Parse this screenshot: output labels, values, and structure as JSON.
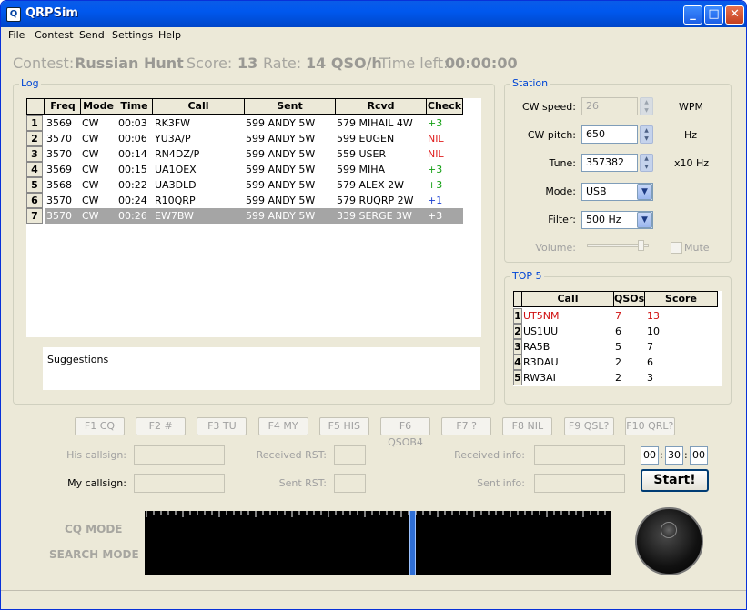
{
  "window": {
    "title": "QRPSim",
    "icon_text": "Q"
  },
  "menu": [
    "File",
    "Contest",
    "Send",
    "Settings",
    "Help"
  ],
  "header": {
    "contest_label": "Contest:",
    "contest_value": "Russian Hunt",
    "score_label": "Score:",
    "score_value": "13",
    "rate_label": "Rate:",
    "rate_value": "14 QSO/h",
    "time_label": "Time left:",
    "time_value": "00:00:00"
  },
  "log": {
    "label": "Log",
    "columns": [
      "Freq",
      "Mode",
      "Time",
      "Call",
      "Sent",
      "Rcvd",
      "Check"
    ],
    "rows": [
      {
        "n": "1",
        "freq": "3569",
        "mode": "CW",
        "time": "00:03",
        "call": "RK3FW",
        "sent": "599 ANDY 5W",
        "rcvd": "579 MIHAIL 4W",
        "check": "+3",
        "check_color": "#16a016"
      },
      {
        "n": "2",
        "freq": "3570",
        "mode": "CW",
        "time": "00:06",
        "call": "YU3A/P",
        "sent": "599 ANDY 5W",
        "rcvd": "599 EUGEN",
        "check": "NIL",
        "check_color": "#e02020"
      },
      {
        "n": "3",
        "freq": "3570",
        "mode": "CW",
        "time": "00:14",
        "call": "RN4DZ/P",
        "sent": "599 ANDY 5W",
        "rcvd": "559 USER",
        "check": "NIL",
        "check_color": "#e02020"
      },
      {
        "n": "4",
        "freq": "3569",
        "mode": "CW",
        "time": "00:15",
        "call": "UA1OEX",
        "sent": "599 ANDY 5W",
        "rcvd": "599 MIHA",
        "check": "+3",
        "check_color": "#16a016"
      },
      {
        "n": "5",
        "freq": "3568",
        "mode": "CW",
        "time": "00:22",
        "call": "UA3DLD",
        "sent": "599 ANDY 5W",
        "rcvd": "579 ALEX 2W",
        "check": "+3",
        "check_color": "#16a016"
      },
      {
        "n": "6",
        "freq": "3570",
        "mode": "CW",
        "time": "00:24",
        "call": "R10QRP",
        "sent": "599 ANDY 5W",
        "rcvd": "579 RUQRP 2W",
        "check": "+1",
        "check_color": "#1a3fd0"
      },
      {
        "n": "7",
        "freq": "3570",
        "mode": "CW",
        "time": "00:26",
        "call": "EW7BW",
        "sent": "599 ANDY 5W",
        "rcvd": "339 SERGE 3W",
        "check": "+3",
        "check_color": "#ffffff"
      }
    ],
    "suggestions_label": "Suggestions"
  },
  "station": {
    "label": "Station",
    "cw_speed_label": "CW speed:",
    "cw_speed": "26",
    "cw_speed_unit": "WPM",
    "cw_pitch_label": "CW pitch:",
    "cw_pitch": "650",
    "cw_pitch_unit": "Hz",
    "tune_label": "Tune:",
    "tune": "357382",
    "tune_unit": "x10 Hz",
    "mode_label": "Mode:",
    "mode": "USB",
    "filter_label": "Filter:",
    "filter": "500 Hz",
    "volume_label": "Volume:",
    "volume_level": 0.92,
    "mute_label": "Mute"
  },
  "top5": {
    "label": "TOP 5",
    "columns": [
      "Call",
      "QSOs",
      "Score"
    ],
    "rows": [
      {
        "n": "1",
        "call": "UT5NM",
        "qsos": "7",
        "score": "13",
        "color": "#d01010"
      },
      {
        "n": "2",
        "call": "US1UU",
        "qsos": "6",
        "score": "10",
        "color": "#000000"
      },
      {
        "n": "3",
        "call": "RA5B",
        "qsos": "5",
        "score": "7",
        "color": "#000000"
      },
      {
        "n": "4",
        "call": "R3DAU",
        "qsos": "2",
        "score": "6",
        "color": "#000000"
      },
      {
        "n": "5",
        "call": "RW3AI",
        "qsos": "2",
        "score": "3",
        "color": "#000000"
      }
    ]
  },
  "fkeys": [
    "F1 CQ",
    "F2 #",
    "F3 TU",
    "F4 MY",
    "F5 HIS",
    "F6 QSOB4",
    "F7 ?",
    "F8 NIL",
    "F9 QSL?",
    "F10 QRL?"
  ],
  "fields": {
    "his_callsign": "His callsign:",
    "my_callsign": "My callsign:",
    "received_rst": "Received RST:",
    "sent_rst": "Sent RST:",
    "received_info": "Received info:",
    "sent_info": "Sent info:"
  },
  "timer": {
    "h": "00",
    "m": "30",
    "s": "00"
  },
  "start_label": "Start!",
  "modes": {
    "cq": "CQ MODE",
    "search": "SEARCH MODE"
  }
}
